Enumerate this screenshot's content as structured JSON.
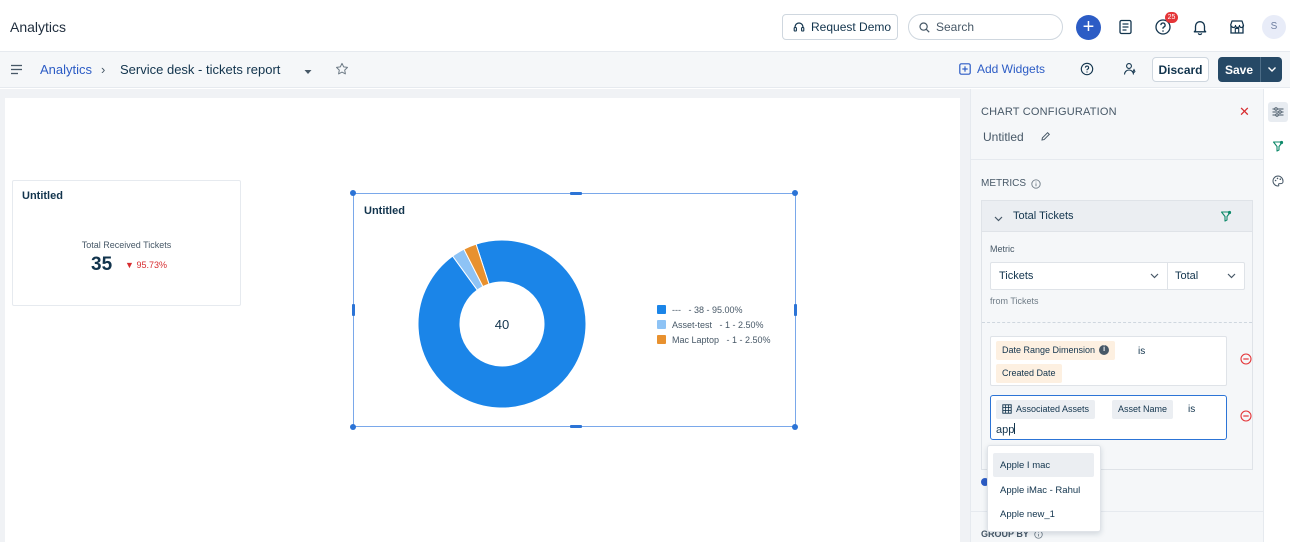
{
  "app": {
    "title": "Analytics"
  },
  "topbar": {
    "request_demo": "Request Demo",
    "search_placeholder": "Search",
    "notification_count": "25",
    "avatar_initial": "S"
  },
  "subbar": {
    "breadcrumb_root": "Analytics",
    "breadcrumb_sep": "›",
    "report_name": "Service desk - tickets report",
    "add_widgets": "Add Widgets",
    "discard": "Discard",
    "save": "Save"
  },
  "kpi": {
    "title": "Untitled",
    "label": "Total Received Tickets",
    "value": "35",
    "change": "95.73%",
    "change_color": "#d72d30"
  },
  "chart_widget": {
    "title": "Untitled"
  },
  "chart_data": {
    "type": "pie",
    "title": "Untitled",
    "center_label": "40",
    "categories": [
      "---",
      "Asset-test",
      "Mac Laptop"
    ],
    "values": [
      38,
      1,
      1
    ],
    "labels": [
      "---   - 38 - 95.00%",
      "Asset-test   - 1 - 2.50%",
      "Mac Laptop   - 1 - 2.50%"
    ],
    "colors": [
      "#1b85e8",
      "#8ec3f5",
      "#e8912f"
    ],
    "legend": "right"
  },
  "config": {
    "heading": "CHART CONFIGURATION",
    "chart_name": "Untitled",
    "metrics_label": "METRICS",
    "metric_name": "Total Tickets",
    "metric_field_label": "Metric",
    "metric_select": "Tickets",
    "aggregate_select": "Total",
    "from_label": "from Tickets",
    "cond1": {
      "dimension": "Date Range Dimension",
      "operator": "is",
      "value": "Created Date"
    },
    "cond2": {
      "entity": "Associated Assets",
      "field": "Asset Name",
      "operator": "is",
      "typed": "app"
    },
    "suggestions": [
      "Apple I mac",
      "Apple iMac - Rahul",
      "Apple new_1"
    ],
    "group_by_label": "GROUP BY"
  }
}
